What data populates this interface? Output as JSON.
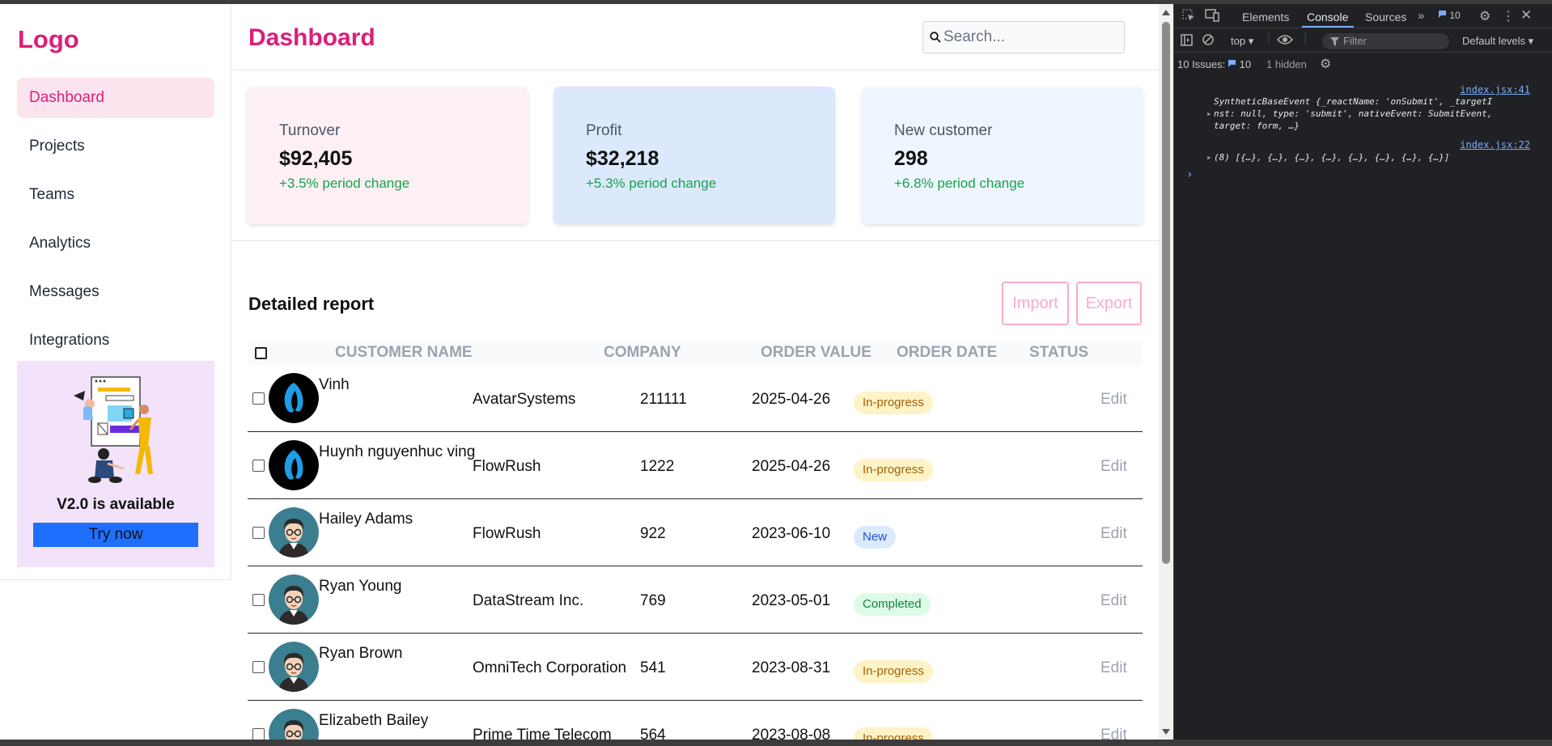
{
  "app": {
    "logo": "Logo",
    "page_title": "Dashboard",
    "search_placeholder": "Search...",
    "nav": [
      {
        "label": "Dashboard",
        "active": true
      },
      {
        "label": "Projects"
      },
      {
        "label": "Teams"
      },
      {
        "label": "Analytics"
      },
      {
        "label": "Messages"
      },
      {
        "label": "Integrations"
      }
    ],
    "promo": {
      "title": "V2.0 is available",
      "button": "Try now"
    },
    "stats": [
      {
        "label": "Turnover",
        "value": "$92,405",
        "change": "+3.5% period change",
        "bg": "#fdf0f5"
      },
      {
        "label": "Profit",
        "value": "$32,218",
        "change": "+5.3% period change",
        "bg": "#dce9fd"
      },
      {
        "label": "New customer",
        "value": "298",
        "change": "+6.8% period change",
        "bg": "#eff5ff"
      }
    ],
    "report": {
      "title": "Detailed report",
      "import_label": "Import",
      "export_label": "Export",
      "columns": [
        "CUSTOMER NAME",
        "COMPANY",
        "ORDER VALUE",
        "ORDER DATE",
        "STATUS"
      ],
      "rows": [
        {
          "name": "Vinh",
          "company": "AvatarSystems",
          "value": "211111",
          "date": "2025-04-26",
          "status": "In-progress",
          "avatar": "logo",
          "edit": "Edit"
        },
        {
          "name": "Huynh nguyenhuc ving",
          "company": "FlowRush",
          "value": "1222",
          "date": "2025-04-26",
          "status": "In-progress",
          "avatar": "logo",
          "edit": "Edit"
        },
        {
          "name": "Hailey Adams",
          "company": "FlowRush",
          "value": "922",
          "date": "2023-06-10",
          "status": "New",
          "avatar": "person",
          "edit": "Edit"
        },
        {
          "name": "Ryan Young",
          "company": "DataStream Inc.",
          "value": "769",
          "date": "2023-05-01",
          "status": "Completed",
          "avatar": "person",
          "edit": "Edit"
        },
        {
          "name": "Ryan Brown",
          "company": "OmniTech Corporation",
          "value": "541",
          "date": "2023-08-31",
          "status": "In-progress",
          "avatar": "person",
          "edit": "Edit"
        },
        {
          "name": "Elizabeth Bailey",
          "company": "Prime Time Telecom",
          "value": "564",
          "date": "2023-08-08",
          "status": "In-progress",
          "avatar": "person",
          "edit": "Edit"
        }
      ]
    }
  },
  "devtools": {
    "tabs": [
      "Elements",
      "Console",
      "Sources"
    ],
    "active_tab": "Console",
    "issues_badge": "10",
    "context": "top",
    "filter_placeholder": "Filter",
    "levels": "Default levels",
    "issues_label": "10 Issues:",
    "issues_count": "10",
    "hidden_label": "1 hidden",
    "console": {
      "src1": "index.jsx:41",
      "src2": "index.jsx:22",
      "log1_head": "SyntheticBaseEvent {_reactName: 'onSubmit', _targetI",
      "log1_line2": "nst: null, type: 'submit', nativeEvent: SubmitEvent,",
      "log1_line3": "target: form, …}",
      "log2": "(8) [{…}, {…}, {…}, {…}, {…}, {…}, {…}, {…}]"
    }
  }
}
